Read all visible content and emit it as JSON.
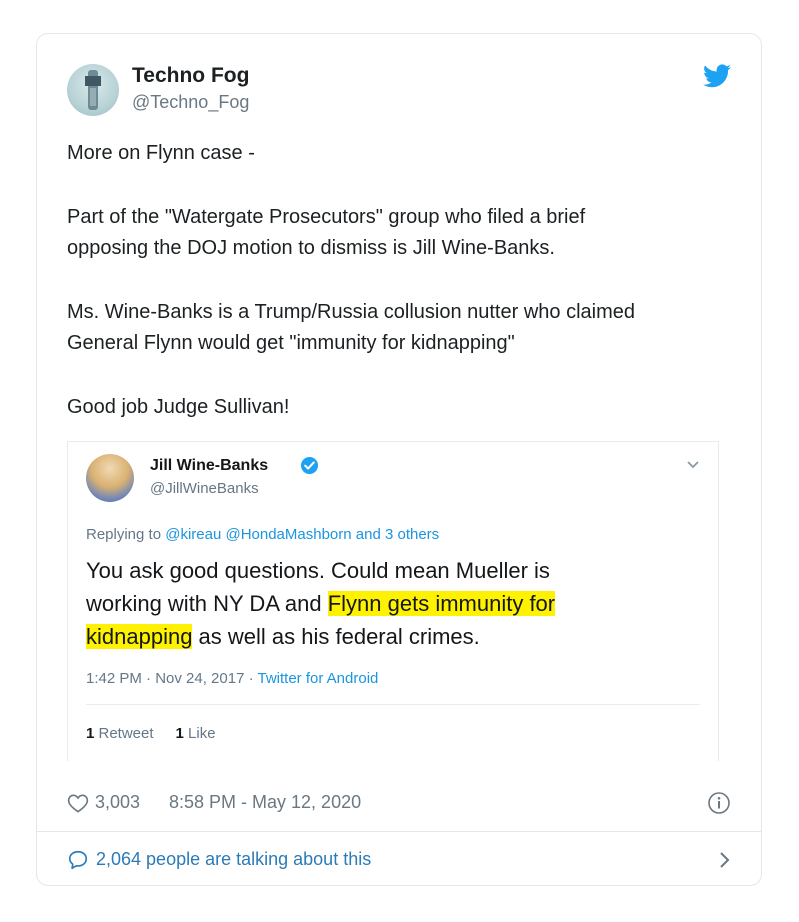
{
  "tweet": {
    "author": {
      "name": "Techno Fog",
      "handle": "@Techno_Fog"
    },
    "paragraphs": [
      [
        "More on Flynn case -"
      ],
      [
        "Part of the \"Watergate Prosecutors\" group who filed a brief",
        "opposing the DOJ motion to dismiss is Jill Wine-Banks."
      ],
      [
        "Ms. Wine-Banks is a Trump/Russia collusion nutter who claimed",
        "General Flynn would get \"immunity for kidnapping\""
      ],
      [
        "Good job Judge Sullivan!"
      ]
    ],
    "likes": "3,003",
    "timestamp": "8:58 PM - May 12, 2020",
    "talking": "2,064 people are talking about this"
  },
  "embedded": {
    "name": "Jill Wine-Banks",
    "handle": "@JillWineBanks",
    "replying_prefix": "Replying to ",
    "replying_mentions": "@kireau @HondaMashborn",
    "replying_suffix": " and 3 others",
    "text": {
      "line1": "You ask good questions. Could mean  Mueller is",
      "line2_pre": "working with NY DA and ",
      "line2_hl": "Flynn gets immunity for",
      "line3_hl": "kidnapping",
      "line3_post": " as well as his federal crimes."
    },
    "meta_time": "1:42 PM · Nov 24, 2017 · ",
    "meta_source": "Twitter for Android",
    "retweets_count": "1",
    "retweets_label": " Retweet",
    "likes_count": "1",
    "likes_label": " Like"
  },
  "colors": {
    "twitter_blue": "#1da1f2",
    "link_blue": "#1b95e0",
    "highlight": "#fff200",
    "muted_text": "#697882"
  },
  "icons": [
    "twitter-bird-icon",
    "verified-badge-icon",
    "chevron-down-icon",
    "heart-icon",
    "info-icon",
    "speech-bubble-icon",
    "chevron-right-icon"
  ]
}
